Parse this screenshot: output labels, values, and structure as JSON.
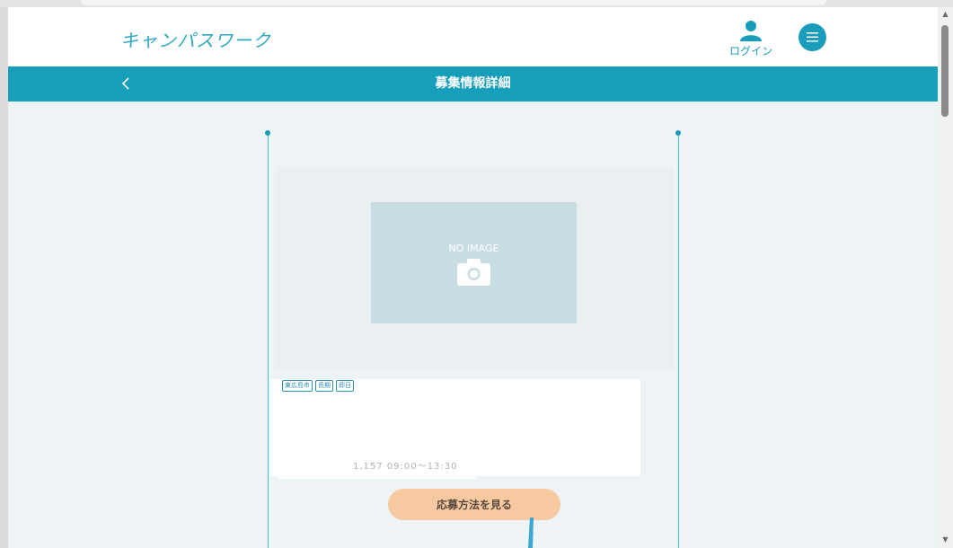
{
  "header": {
    "logo_text": "キャンパスワーク",
    "login_label": "ログイン",
    "login_icon": "user-icon",
    "menu_icon": "hamburger-menu-icon"
  },
  "titlebar": {
    "back_icon": "chevron-left-icon",
    "title": "募集情報詳細"
  },
  "job": {
    "image_placeholder": "NO IMAGE",
    "image_icon": "camera-icon",
    "tags": [
      "東広島市",
      "長期",
      "即日"
    ],
    "hours": "1,157   09:00～13:30",
    "apply_label": "応募方法を見る"
  },
  "colors": {
    "primary": "#169ebb",
    "apply_button": "#f6c9a0",
    "page_background": "#eef3f5",
    "placeholder": "#c7dde2"
  }
}
